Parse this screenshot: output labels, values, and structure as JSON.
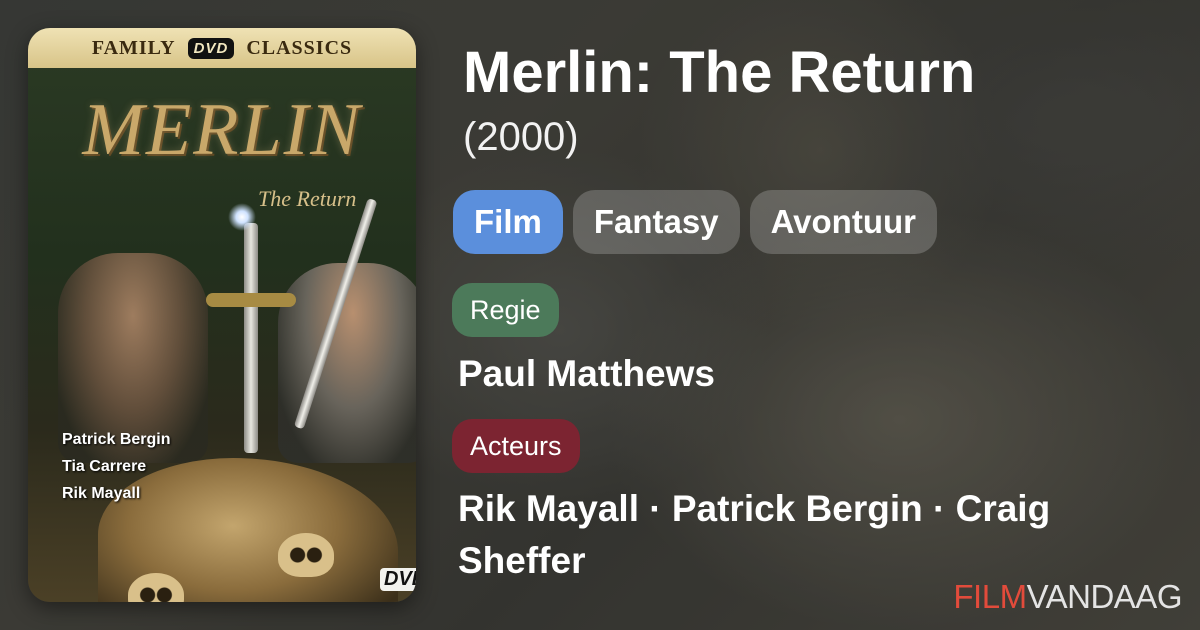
{
  "poster": {
    "banner_left": "FAMILY",
    "banner_badge": "DVD",
    "banner_right": "CLASSICS",
    "title": "MERLIN",
    "subtitle": "The Return",
    "cast": [
      "Patrick Bergin",
      "Tia Carrere",
      "Rik Mayall"
    ],
    "format_logo": "DVD"
  },
  "movie": {
    "title": "Merlin: The Return",
    "year": "(2000)"
  },
  "tags": [
    {
      "label": "Film",
      "color": "#5b8fdc"
    },
    {
      "label": "Fantasy"
    },
    {
      "label": "Avontuur"
    }
  ],
  "director": {
    "label": "Regie",
    "label_color": "#4c7a5a",
    "value": "Paul Matthews"
  },
  "actors": {
    "label": "Acteurs",
    "label_color": "#7c2431",
    "value": "Rik Mayall · Patrick Bergin · Craig Sheffer"
  },
  "brand": {
    "part1": "FILM",
    "part2": "VANDAAG",
    "color1": "#e24b3b"
  }
}
